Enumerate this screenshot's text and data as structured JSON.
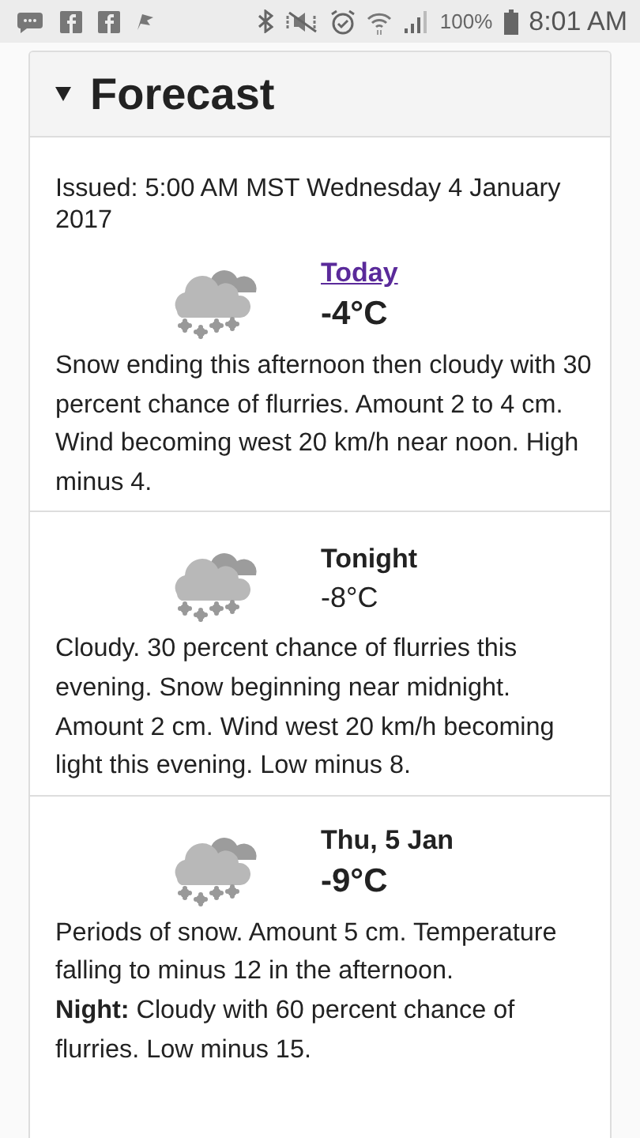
{
  "status_bar": {
    "battery": "100%",
    "time": "8:01 AM"
  },
  "section": {
    "title": "Forecast",
    "expanded": true
  },
  "issued": "Issued: 5:00 AM MST Wednesday 4 January 2017",
  "periods": [
    {
      "kind": "link",
      "title": "Today",
      "temperature": "-4°C",
      "bold_temperature": true,
      "summary": "Snow ending this afternoon then cloudy with 30 percent chance of flurries. Amount 2 to 4 cm. Wind becoming west 20 km/h near noon. High minus 4."
    },
    {
      "kind": "plain",
      "title": "Tonight",
      "temperature": "-8°C",
      "bold_temperature": false,
      "summary": "Cloudy. 30 percent chance of flurries this evening. Snow beginning near midnight. Amount 2 cm. Wind west 20 km/h becoming light this evening. Low minus 8."
    },
    {
      "kind": "plain",
      "title": "Thu, 5 Jan",
      "temperature": "-9°C",
      "bold_temperature": true,
      "summary": "Periods of snow. Amount 5 cm. Temperature falling to minus 12 in the afternoon.",
      "night": "**Night:** Cloudy with 60 percent chance of flurries. Low minus 15."
    }
  ]
}
